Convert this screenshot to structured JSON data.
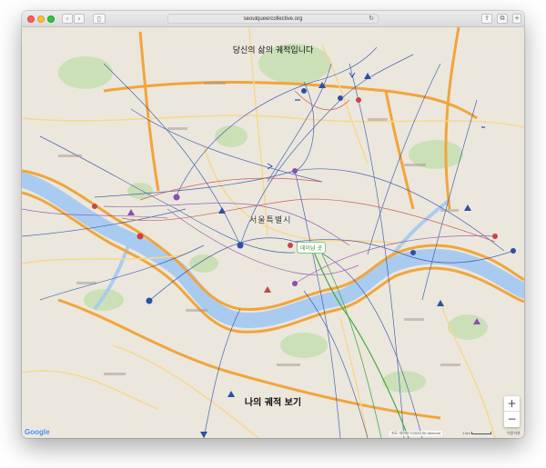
{
  "browser": {
    "url": "seoulqueercollective.org",
    "reload_icon": "reload-icon",
    "back_icon": "chevron-left-icon",
    "forward_icon": "chevron-right-icon"
  },
  "page": {
    "top_heading": "당신의 삶의 궤적입니다",
    "bottom_heading": "나의 궤적 보기",
    "city_label": "서울특별시",
    "place_tag": "데이남 곳"
  },
  "map": {
    "zoom_in": "+",
    "zoom_out": "−",
    "logo": "Google",
    "attribution": "지도 데이터 ©2020 SK telecom",
    "scale_label": "1 km",
    "terms": "이용약관"
  },
  "colors": {
    "river": "#aacbf0",
    "expressway": "#f2a53a",
    "park": "#c8dfb2",
    "route_blue": "#2c4fa8",
    "route_purple": "#8a4fb0",
    "route_red": "#c94444",
    "route_green": "#2aa02a"
  }
}
